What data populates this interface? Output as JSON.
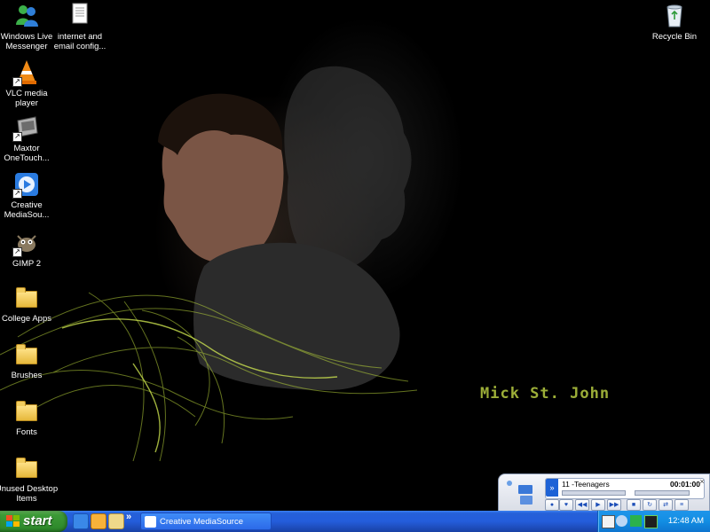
{
  "desktop": {
    "icons": [
      {
        "label": "Windows Live Messenger",
        "icon": "messenger-icon"
      },
      {
        "label": "internet and email config...",
        "icon": "document-icon"
      },
      {
        "label": "VLC media player",
        "icon": "vlc-cone-icon"
      },
      {
        "label": "Maxtor OneTouch...",
        "icon": "drive-icon"
      },
      {
        "label": "Creative MediaSou...",
        "icon": "mediasource-icon"
      },
      {
        "label": "GIMP 2",
        "icon": "gimp-icon"
      },
      {
        "label": "College Apps",
        "icon": "folder-icon"
      },
      {
        "label": "Brushes",
        "icon": "folder-icon"
      },
      {
        "label": "Fonts",
        "icon": "folder-icon"
      },
      {
        "label": "Unused Desktop Items",
        "icon": "folder-icon"
      },
      {
        "label": "Recycle Bin",
        "icon": "recycle-bin-icon"
      }
    ],
    "wallpaper_text": "Mick St. John",
    "wallpaper_text_color": "#9cae38"
  },
  "taskbar": {
    "start_label": "start",
    "more_chevron": "»",
    "task_button_label": "Creative MediaSource",
    "clock": "12:48 AM"
  },
  "media_player": {
    "track": "11 -Teenagers",
    "time": "00:01:00"
  },
  "colors": {
    "taskbar_blue": "#245ddb",
    "start_green": "#3c9a36",
    "tray_blue": "#128ee3"
  }
}
